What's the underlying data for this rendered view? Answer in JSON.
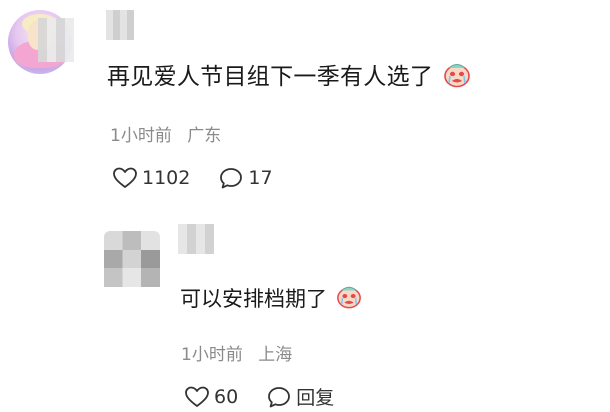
{
  "comment": {
    "text": "再见爱人节目组下一季有人选了",
    "time": "1小时前",
    "location": "广东",
    "likes": "1102",
    "replies": "17",
    "emoji": "crying-face-emoji"
  },
  "reply": {
    "text": "可以安排档期了",
    "time": "1小时前",
    "location": "上海",
    "likes": "60",
    "reply_label": "回复",
    "emoji": "crying-face-emoji"
  },
  "colors": {
    "meta_gray": "#8a8a8a",
    "text": "#1a1a1a",
    "emoji_red": "#e5484d",
    "emoji_face": "#f7d9c4"
  }
}
